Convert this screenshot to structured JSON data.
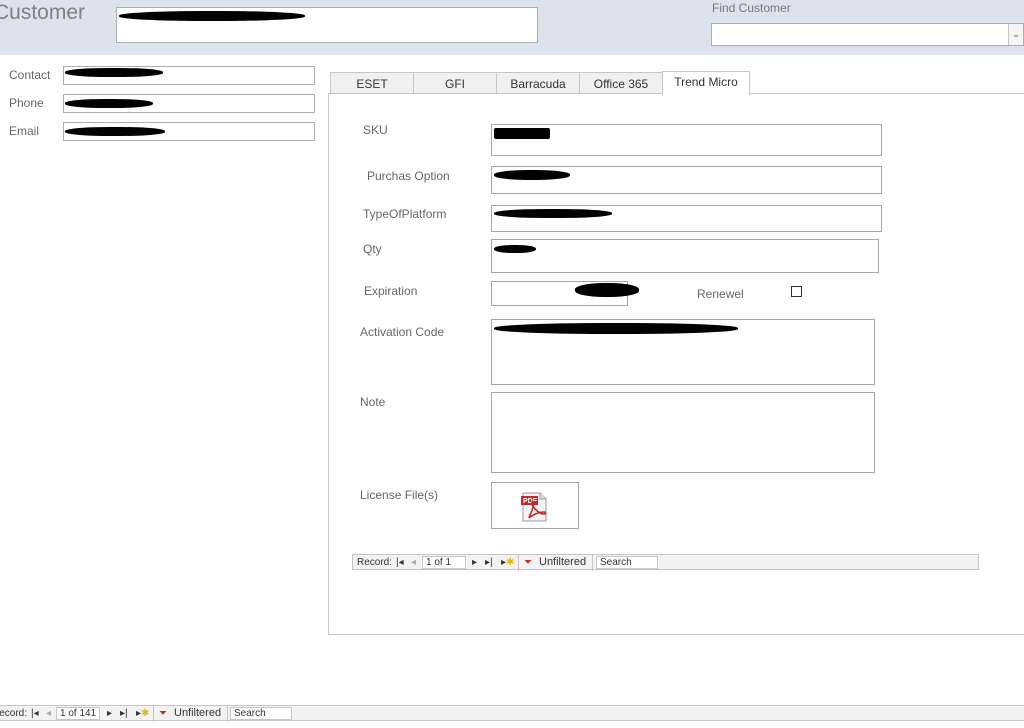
{
  "header": {
    "title": "Customer",
    "find_label": "Find Customer",
    "find_value": "",
    "dropdown_glyph": "⌄"
  },
  "customer": {
    "contact_label": "Contact",
    "phone_label": "Phone",
    "email_label": "Email"
  },
  "tabs": [
    {
      "label": "ESET"
    },
    {
      "label": "GFI"
    },
    {
      "label": "Barracuda"
    },
    {
      "label": "Office 365"
    },
    {
      "label": "Trend Micro"
    }
  ],
  "active_tab": "Trend Micro",
  "form": {
    "sku_label": "SKU",
    "purchase_option_label": "Purchas Option",
    "platform_label": "TypeOfPlatform",
    "qty_label": "Qty",
    "expiration_label": "Expiration",
    "renewal_label": "Renewel",
    "renewal_checked": false,
    "activation_label": "Activation Code",
    "note_label": "Note",
    "license_label": "License File(s)",
    "license_attachment_icon": "pdf-file-icon"
  },
  "subform_nav": {
    "record_label": "Record:",
    "position": "1 of 1",
    "filter_label": "Unfiltered",
    "search_placeholder": "Search"
  },
  "main_nav": {
    "record_label": "Record:",
    "position": "1 of 141",
    "filter_label": "Unfiltered",
    "search_placeholder": "Search"
  },
  "colors": {
    "header_bg": "#dce3ed",
    "pdf_red": "#d32f2f"
  }
}
